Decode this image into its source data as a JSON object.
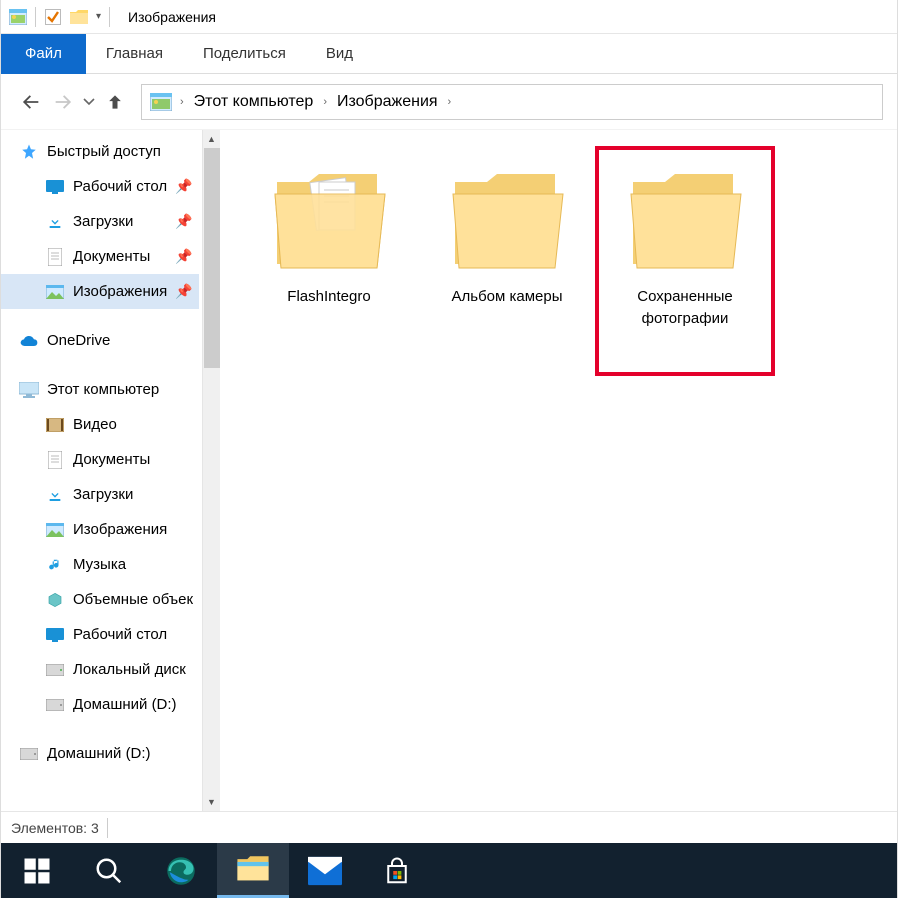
{
  "window": {
    "title": "Изображения"
  },
  "ribbon": {
    "file": "Файл",
    "tabs": [
      "Главная",
      "Поделиться",
      "Вид"
    ]
  },
  "breadcrumb": {
    "items": [
      "Этот компьютер",
      "Изображения"
    ]
  },
  "nav": {
    "quick_access": "Быстрый доступ",
    "quick_items": [
      {
        "label": "Рабочий стол",
        "icon": "desktop",
        "pinned": true
      },
      {
        "label": "Загрузки",
        "icon": "downloads",
        "pinned": true
      },
      {
        "label": "Документы",
        "icon": "documents",
        "pinned": true
      },
      {
        "label": "Изображения",
        "icon": "pictures",
        "pinned": true,
        "selected": true
      }
    ],
    "onedrive": "OneDrive",
    "this_pc": "Этот компьютер",
    "pc_items": [
      {
        "label": "Видео",
        "icon": "videos"
      },
      {
        "label": "Документы",
        "icon": "documents"
      },
      {
        "label": "Загрузки",
        "icon": "downloads"
      },
      {
        "label": "Изображения",
        "icon": "pictures"
      },
      {
        "label": "Музыка",
        "icon": "music"
      },
      {
        "label": "Объемные объекты",
        "icon": "objects3d"
      },
      {
        "label": "Рабочий стол",
        "icon": "desktop"
      },
      {
        "label": "Локальный диск",
        "icon": "drive"
      },
      {
        "label": "Домашний (D:)",
        "icon": "drive"
      }
    ],
    "extra_drive": "Домашний (D:)"
  },
  "folders": [
    {
      "label": "FlashIntegro",
      "variant": "docs"
    },
    {
      "label": "Альбом камеры",
      "variant": "empty"
    },
    {
      "label": "Сохраненные фотографии",
      "variant": "empty",
      "highlight": true
    }
  ],
  "status": {
    "items_label": "Элементов: 3"
  }
}
